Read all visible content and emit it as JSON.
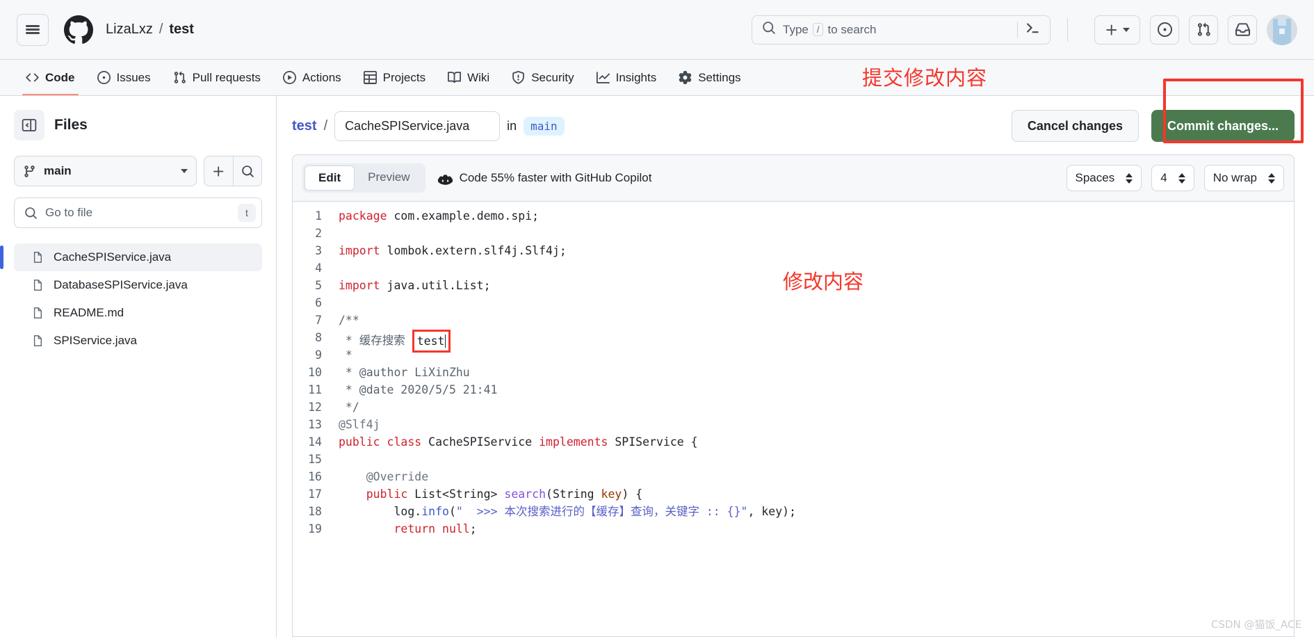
{
  "header": {
    "menu_icon": "hamburger-icon",
    "logo_icon": "github-logo-icon",
    "owner": "LizaLxz",
    "separator": "/",
    "repo": "test",
    "search": {
      "icon": "search-icon",
      "placeholder_before": "Type",
      "slash_key": "/",
      "placeholder_after": "to search",
      "terminal_icon": "terminal-icon"
    },
    "actions": [
      {
        "name": "create-new-button",
        "icon": "plus-icon",
        "caret": "chevron-down-icon"
      },
      {
        "name": "issues-button",
        "icon": "issue-opened-icon"
      },
      {
        "name": "pull-requests-button",
        "icon": "git-pull-request-icon"
      },
      {
        "name": "inbox-button",
        "icon": "inbox-icon"
      },
      {
        "name": "user-avatar",
        "icon": "avatar-icon"
      }
    ]
  },
  "repo_nav": {
    "items": [
      {
        "label": "Code",
        "icon": "code-icon",
        "selected": true
      },
      {
        "label": "Issues",
        "icon": "issue-opened-icon",
        "selected": false
      },
      {
        "label": "Pull requests",
        "icon": "git-pull-request-icon",
        "selected": false
      },
      {
        "label": "Actions",
        "icon": "play-icon",
        "selected": false
      },
      {
        "label": "Projects",
        "icon": "table-icon",
        "selected": false
      },
      {
        "label": "Wiki",
        "icon": "book-icon",
        "selected": false
      },
      {
        "label": "Security",
        "icon": "shield-icon",
        "selected": false
      },
      {
        "label": "Insights",
        "icon": "graph-icon",
        "selected": false
      },
      {
        "label": "Settings",
        "icon": "gear-icon",
        "selected": false
      }
    ],
    "annotation": "提交修改内容"
  },
  "sidebar": {
    "panel_toggle_icon": "sidebar-collapse-icon",
    "title": "Files",
    "branch": {
      "icon": "git-branch-icon",
      "name": "main",
      "caret": "chevron-down-icon"
    },
    "add_file_icon": "plus-icon",
    "search_files_icon": "search-icon",
    "go_to_file": {
      "icon": "search-icon",
      "placeholder": "Go to file",
      "key_hint": "t"
    },
    "files": [
      {
        "name": "CacheSPIService.java",
        "active": true
      },
      {
        "name": "DatabaseSPIService.java",
        "active": false
      },
      {
        "name": "README.md",
        "active": false
      },
      {
        "name": "SPIService.java",
        "active": false
      }
    ]
  },
  "editor": {
    "breadcrumb_repo": "test",
    "breadcrumb_slash": "/",
    "filename_value": "CacheSPIService.java",
    "in_label": "in",
    "branch_chip": "main",
    "cancel_label": "Cancel changes",
    "commit_label": "Commit changes...",
    "tabs": [
      {
        "label": "Edit",
        "active": true
      },
      {
        "label": "Preview",
        "active": false
      }
    ],
    "copilot": {
      "icon": "copilot-icon",
      "text": "Code 55% faster with GitHub Copilot"
    },
    "settings": [
      {
        "name": "indent-mode-select",
        "value": "Spaces"
      },
      {
        "name": "indent-size-select",
        "value": "4"
      },
      {
        "name": "wrap-mode-select",
        "value": "No wrap"
      }
    ],
    "annotation_mid": "修改内容"
  },
  "code": {
    "lines": [
      {
        "n": "1",
        "tokens": [
          {
            "t": "package ",
            "c": "k"
          },
          {
            "t": "com.example.demo.spi;",
            "c": "s"
          }
        ]
      },
      {
        "n": "2",
        "tokens": []
      },
      {
        "n": "3",
        "tokens": [
          {
            "t": "import ",
            "c": "k"
          },
          {
            "t": "lombok.extern.slf4j.Slf4j;",
            "c": "s"
          }
        ]
      },
      {
        "n": "4",
        "tokens": []
      },
      {
        "n": "5",
        "tokens": [
          {
            "t": "import ",
            "c": "k"
          },
          {
            "t": "java.util.List;",
            "c": "s"
          }
        ]
      },
      {
        "n": "6",
        "tokens": []
      },
      {
        "n": "7",
        "tokens": [
          {
            "t": "/**",
            "c": "cm"
          }
        ]
      },
      {
        "n": "8",
        "tokens": [
          {
            "t": " * 缓存搜索 ",
            "c": "cm"
          },
          {
            "t": "test",
            "c": "boxed"
          }
        ]
      },
      {
        "n": "9",
        "tokens": [
          {
            "t": " *",
            "c": "cm"
          }
        ]
      },
      {
        "n": "10",
        "tokens": [
          {
            "t": " * @author LiXinZhu",
            "c": "cm"
          }
        ]
      },
      {
        "n": "11",
        "tokens": [
          {
            "t": " * @date 2020/5/5 21:41",
            "c": "cm"
          }
        ]
      },
      {
        "n": "12",
        "tokens": [
          {
            "t": " */",
            "c": "cm"
          }
        ]
      },
      {
        "n": "13",
        "tokens": [
          {
            "t": "@Slf4j",
            "c": "cmb"
          }
        ]
      },
      {
        "n": "14",
        "tokens": [
          {
            "t": "public class ",
            "c": "k"
          },
          {
            "t": "CacheSPIService ",
            "c": "s"
          },
          {
            "t": "implements ",
            "c": "k"
          },
          {
            "t": "SPIService {",
            "c": "s"
          }
        ]
      },
      {
        "n": "15",
        "tokens": []
      },
      {
        "n": "16",
        "tokens": [
          {
            "t": "    @Override",
            "c": "cmb"
          }
        ]
      },
      {
        "n": "17",
        "tokens": [
          {
            "t": "    public ",
            "c": "k"
          },
          {
            "t": "List<String> ",
            "c": "s"
          },
          {
            "t": "search",
            "c": "f"
          },
          {
            "t": "(String ",
            "c": "s"
          },
          {
            "t": "key",
            "c": "param"
          },
          {
            "t": ") {",
            "c": "s"
          }
        ]
      },
      {
        "n": "18",
        "tokens": [
          {
            "t": "        log.",
            "c": "s"
          },
          {
            "t": "info",
            "c": "prop"
          },
          {
            "t": "(",
            "c": "s"
          },
          {
            "t": "\"  >>> 本次搜索进行的【缓存】查询，关键字 :: {}\"",
            "c": "str"
          },
          {
            "t": ", key);",
            "c": "s"
          }
        ]
      },
      {
        "n": "19",
        "tokens": [
          {
            "t": "        return null",
            "c": "k"
          },
          {
            "t": ";",
            "c": "s"
          }
        ]
      }
    ]
  },
  "watermark": "CSDN @猫饭_ACE"
}
